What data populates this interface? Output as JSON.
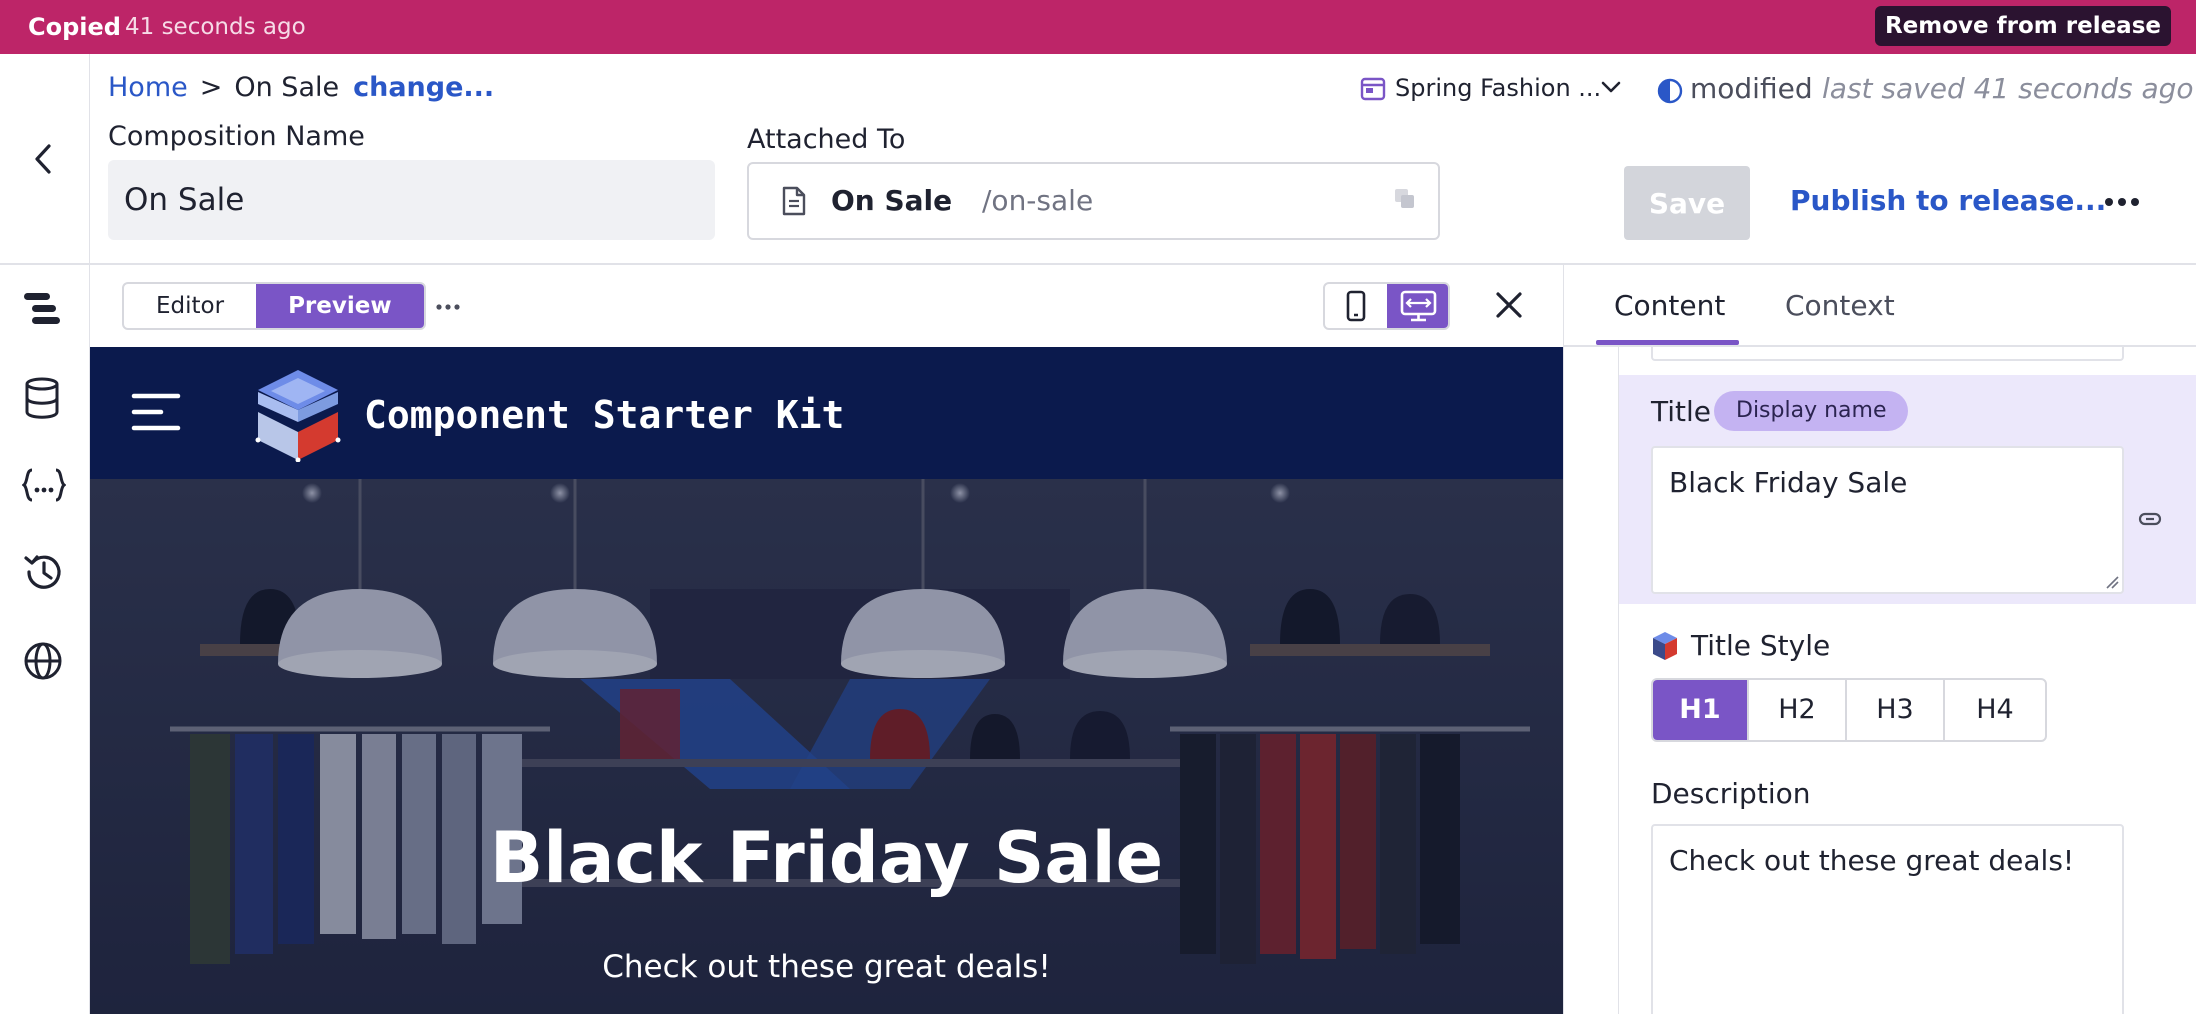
{
  "banner": {
    "copied": "Copied",
    "time": "41 seconds ago",
    "remove_label": "Remove from release",
    "color": "#bd2568"
  },
  "header": {
    "breadcrumb": {
      "home": "Home",
      "separator": ">",
      "current": "On Sale",
      "change": "change..."
    },
    "composition_label": "Composition Name",
    "composition_value": "On Sale",
    "attached_label": "Attached To",
    "attached_name": "On Sale",
    "attached_path": "/on-sale",
    "release_name": "Spring Fashion ...",
    "status": "modified",
    "last_saved": "last saved 41 seconds ago",
    "save_label": "Save",
    "publish_label": "Publish to release...",
    "accent": "#2a57c7"
  },
  "rail": {
    "icons": [
      "structure-icon",
      "data-icon",
      "variables-icon",
      "history-icon",
      "globe-icon"
    ]
  },
  "preview_toolbar": {
    "tabs": [
      "Editor",
      "Preview"
    ],
    "active_tab": "Preview",
    "devices": [
      "mobile-icon",
      "desktop-icon"
    ],
    "active_device": "desktop",
    "accent": "#7a55c6"
  },
  "preview": {
    "brand": "Component Starter Kit",
    "hero_title": "Black Friday Sale",
    "hero_subtitle": "Check out these great deals!"
  },
  "panel": {
    "tabs": [
      "Content",
      "Context"
    ],
    "active_tab": "Content",
    "title_label": "Title",
    "title_badge": "Display name",
    "title_value": "Black Friday Sale",
    "title_style_label": "Title Style",
    "title_style_options": [
      "H1",
      "H2",
      "H3",
      "H4"
    ],
    "title_style_selected": "H1",
    "description_label": "Description",
    "description_value": "Check out these great deals!"
  }
}
